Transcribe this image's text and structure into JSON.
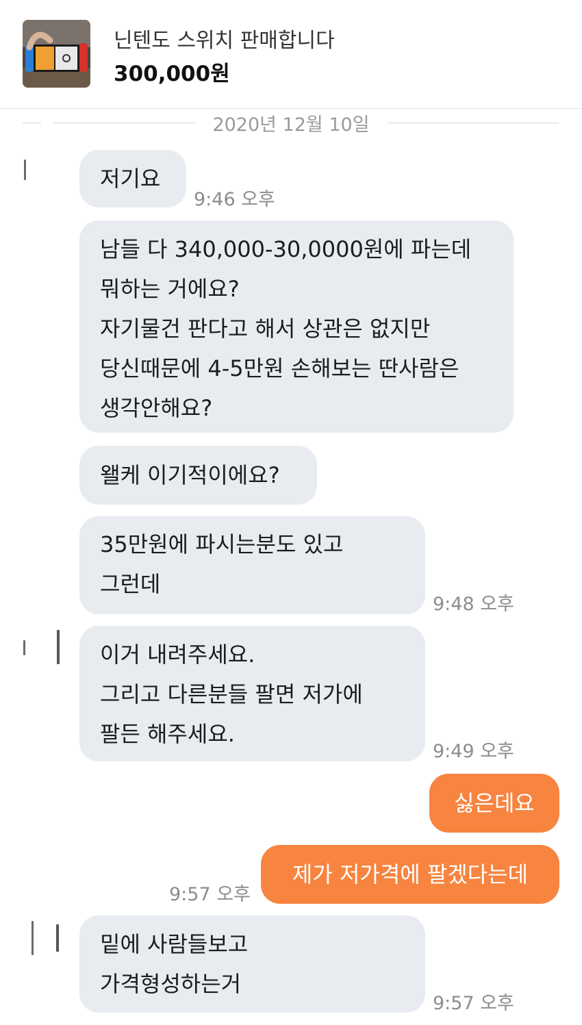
{
  "product": {
    "title": "닌텐도 스위치 판매합니다",
    "price": "300,000원",
    "thumbnail_icon": "nintendo-switch-photo"
  },
  "date_divider": "2020년 12월 10일",
  "messages": [
    {
      "lines": [
        "저기요"
      ],
      "time": "9:46 오후"
    },
    {
      "lines": [
        "남들 다 340,000-30,0000원에 파는데",
        "뭐하는 거에요?",
        "자기물건 판다고 해서 상관은 없지만",
        "당신때문에 4-5만원 손해보는 딴사람은",
        "생각안해요?"
      ]
    },
    {
      "lines": [
        "왤케 이기적이에요?"
      ]
    },
    {
      "lines": [
        "35만원에 파시는분도 있고",
        "그런데"
      ],
      "time": "9:48 오후"
    },
    {
      "lines": [
        "이거 내려주세요.",
        "그리고 다른분들 팔면 저가에",
        "팔든 해주세요."
      ],
      "time": "9:49 오후"
    },
    {
      "lines": [
        "싫은데요"
      ]
    },
    {
      "lines": [
        "제가 저가격에 팔겠다는데"
      ],
      "time": "9:57 오후"
    },
    {
      "lines": [
        "밑에 사람들보고",
        "가격형성하는거"
      ],
      "time": "9:57 오후"
    }
  ],
  "colors": {
    "my_bubble": "#f7843f",
    "their_bubble": "#e8ebef",
    "time_text": "#8c8c8c"
  }
}
